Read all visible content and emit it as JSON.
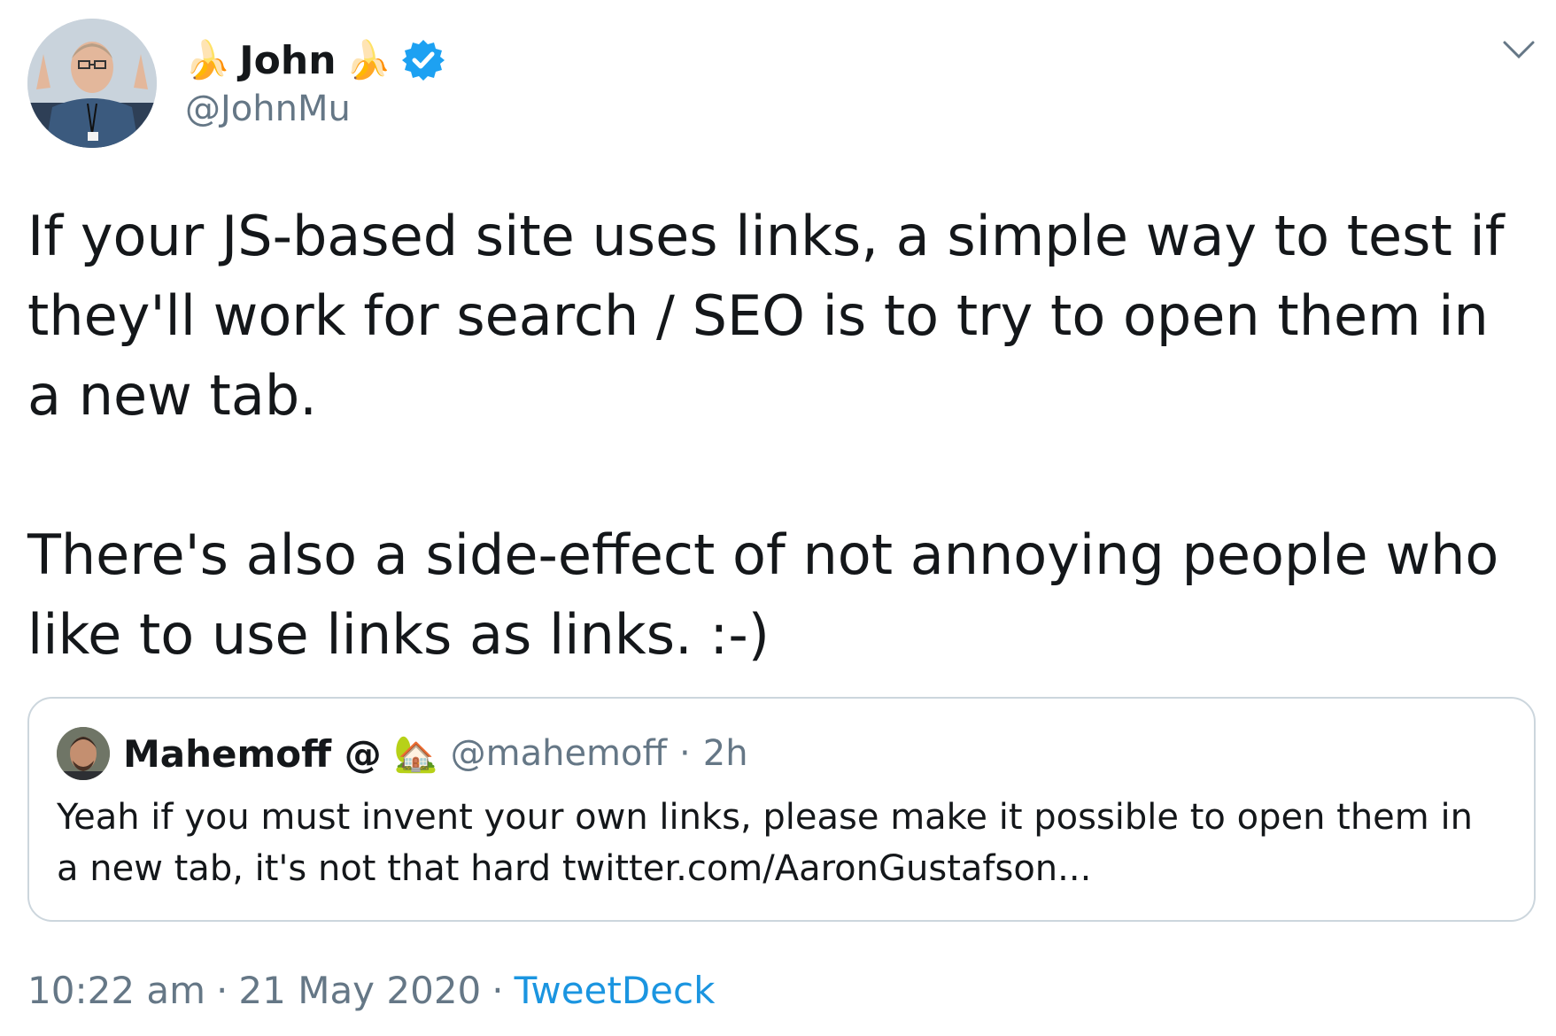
{
  "author": {
    "emoji_left": "🍌",
    "display_name": "John",
    "emoji_right": "🍌",
    "handle": "@JohnMu",
    "verified": true
  },
  "tweet": {
    "text": "If your JS-based site uses links, a simple way to test if they'll work for search / SEO is to try to open them in a new tab.\n\nThere's also a side-effect of not annoying people who like to use links as links. :-)"
  },
  "quoted_tweet": {
    "display_name": "Mahemoff @",
    "emoji": "🏡",
    "handle": "@mahemoff",
    "separator": "·",
    "time": "2h",
    "text": "Yeah if you must invent your own links, please make it possible to open them in a new tab, it's not that hard twitter.com/AaronGustafson..."
  },
  "meta": {
    "time": "10:22 am",
    "separator1": "·",
    "date": "21 May 2020",
    "separator2": "·",
    "source": "TweetDeck"
  },
  "icons": {
    "verified": "verified-badge-icon",
    "menu": "chevron-down-icon"
  },
  "colors": {
    "text": "#14171a",
    "secondary": "#657786",
    "link": "#1b95e0",
    "verified": "#1da1f2",
    "border": "#ccd6dd"
  }
}
